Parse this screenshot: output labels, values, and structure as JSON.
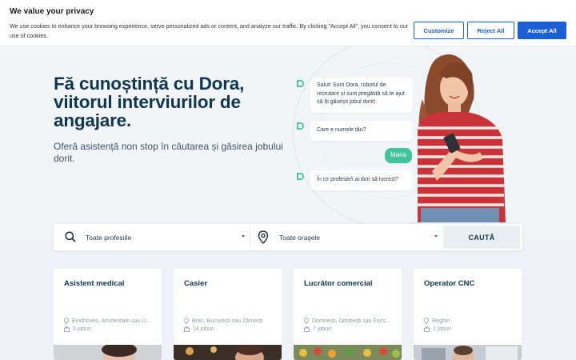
{
  "cookie": {
    "title": "We value your privacy",
    "text": "We use cookies to enhance your browsing experience, serve personalized ads or content, and analyze our traffic. By clicking \"Accept All\", you consent to our use of cookies.",
    "customize": "Customize",
    "reject": "Reject All",
    "accept": "Accept All"
  },
  "hero": {
    "title": "Fă cunoștință cu Dora, viitorul interviurilor de angajare.",
    "subtitle": "Oferă asistență non stop în căutarea și găsirea jobului dorit."
  },
  "chat": {
    "msg1": "Salut! Sunt Dora, robotul de recrutare și sunt pregătită să te ajut să îți găsești jobul dorit!",
    "msg2": "Care e numele tău?",
    "reply": "Maria",
    "msg3": "În ce profesie/i ai dori să lucrezi?"
  },
  "search": {
    "profession": "Toate profesiile",
    "city": "Toate orașele",
    "button": "CAUTĂ"
  },
  "cards": [
    {
      "title": "Asistent medical",
      "location": "Eindhoven, Amsterdam sau U...",
      "jobs": "5 joburi"
    },
    {
      "title": "Casier",
      "location": "Bran, București sau Zărnești",
      "jobs": "14 joburi"
    },
    {
      "title": "Lucrător comercial",
      "location": "Domnești, Odobești sau Focș...",
      "jobs": "7 joburi"
    },
    {
      "title": "Operator CNC",
      "location": "Reghin",
      "jobs": "1 joburi"
    }
  ],
  "colors": {
    "brand_dark": "#0f3650",
    "accent_green": "#3fc39b",
    "button_blue": "#1b5fd6"
  }
}
